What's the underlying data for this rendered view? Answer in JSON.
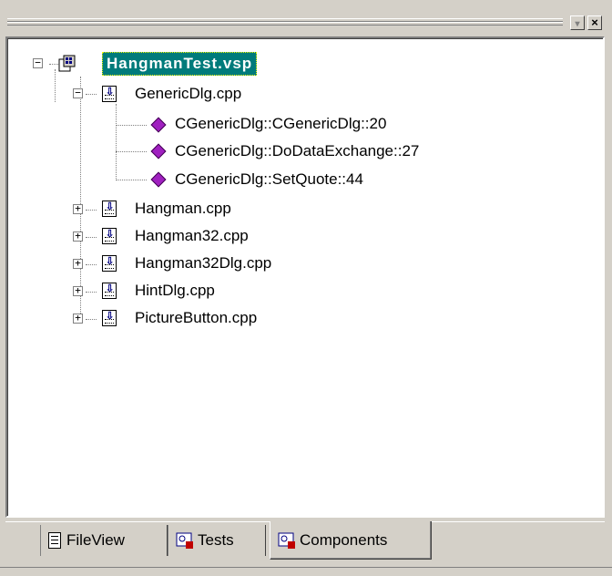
{
  "window": {
    "minimize_glyph": "▾",
    "close_glyph": "×"
  },
  "tree": {
    "project": {
      "label": "HangmanTest.vsp",
      "expanded": true
    },
    "files": [
      {
        "label": "GenericDlg.cpp",
        "expanded": true,
        "children": [
          {
            "label": "CGenericDlg::CGenericDlg::20"
          },
          {
            "label": "CGenericDlg::DoDataExchange::27"
          },
          {
            "label": "CGenericDlg::SetQuote::44"
          }
        ]
      },
      {
        "label": "Hangman.cpp",
        "expanded": false
      },
      {
        "label": "Hangman32.cpp",
        "expanded": false
      },
      {
        "label": "Hangman32Dlg.cpp",
        "expanded": false
      },
      {
        "label": "HintDlg.cpp",
        "expanded": false
      },
      {
        "label": "PictureButton.cpp",
        "expanded": false
      }
    ]
  },
  "tabs": [
    {
      "label": "FileView",
      "active": false
    },
    {
      "label": "Tests",
      "active": false
    },
    {
      "label": "Components",
      "active": true
    }
  ],
  "colors": {
    "selection_bg": "#007b7b",
    "method_icon": "#a020c0",
    "face": "#d4d0c8"
  }
}
